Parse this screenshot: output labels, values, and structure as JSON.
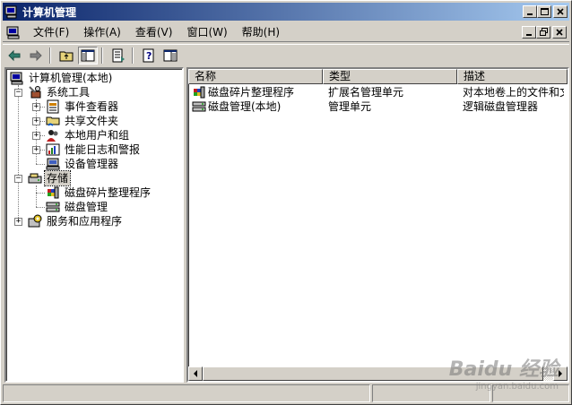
{
  "window": {
    "title": "计算机管理"
  },
  "menu": {
    "items": [
      "文件(F)",
      "操作(A)",
      "查看(V)",
      "窗口(W)",
      "帮助(H)"
    ]
  },
  "tree": {
    "root": "计算机管理(本地)",
    "system_tools": "系统工具",
    "event_viewer": "事件查看器",
    "shared_folders": "共享文件夹",
    "local_users": "本地用户和组",
    "perf_logs": "性能日志和警报",
    "device_manager": "设备管理器",
    "storage": "存储",
    "defrag": "磁盘碎片整理程序",
    "disk_mgmt": "磁盘管理",
    "services": "服务和应用程序"
  },
  "list": {
    "columns": [
      "名称",
      "类型",
      "描述"
    ],
    "rows": [
      {
        "name": "磁盘碎片整理程序",
        "type": "扩展名管理单元",
        "desc": "对本地卷上的文件和文"
      },
      {
        "name": "磁盘管理(本地)",
        "type": "管理单元",
        "desc": "逻辑磁盘管理器"
      }
    ]
  },
  "watermark": {
    "line1": "Baidu 经验",
    "line2": "jingyan.baidu.com"
  }
}
